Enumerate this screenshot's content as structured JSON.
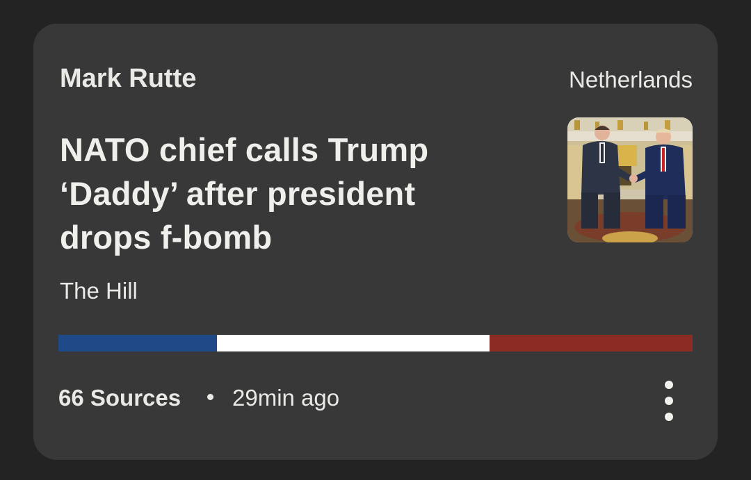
{
  "story": {
    "topic": "Mark Rutte",
    "region": "Netherlands",
    "headline": "NATO chief calls Trump ‘Daddy’ after president drops f-bomb",
    "source": "The Hill",
    "thumbnail_icon": "news-photo-icon"
  },
  "bias": {
    "left_share": 0.25,
    "center_share": 0.43,
    "right_share": 0.32,
    "colors": {
      "left": "#204a87",
      "center": "#ffffff",
      "right": "#8c2a24"
    }
  },
  "footer": {
    "sources_label": "66 Sources",
    "separator": "•",
    "time_label": "29min ago",
    "more_icon": "more-vertical-icon"
  }
}
